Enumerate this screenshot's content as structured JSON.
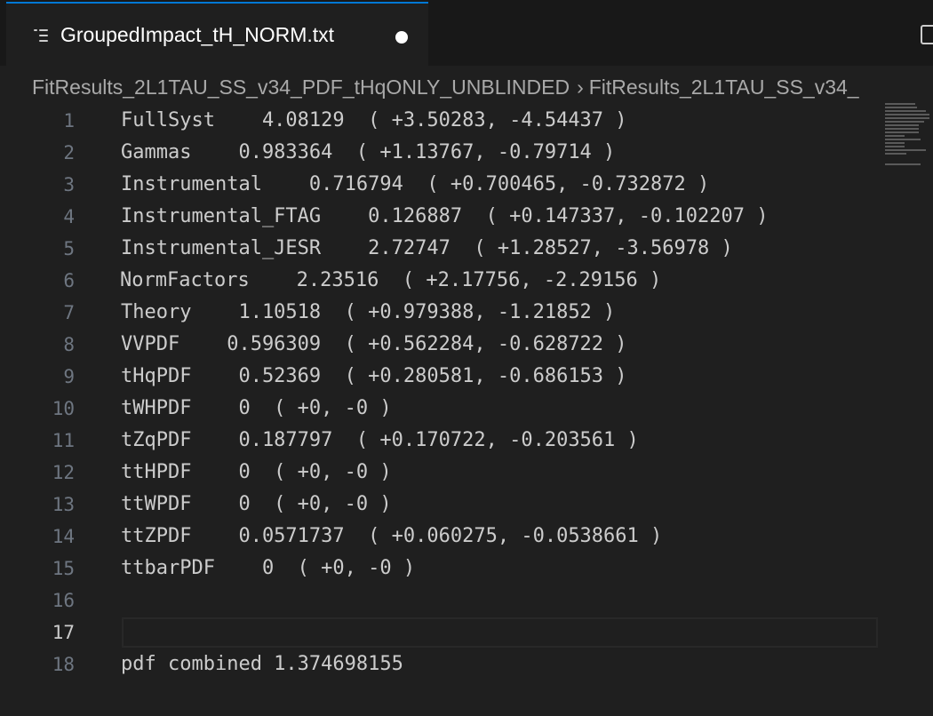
{
  "tab": {
    "title": "GroupedImpact_tH_NORM.txt",
    "dirty": true
  },
  "breadcrumb": [
    "FitResults_2L1TAU_SS_v34_PDF_tHqONLY_UNBLINDED",
    "FitResults_2L1TAU_SS_v34_"
  ],
  "breadcrumb_separator": "›",
  "editor": {
    "active_line": 17,
    "lines": [
      {
        "number": "1",
        "text": "FullSyst    4.08129  ( +3.50283, -4.54437 )"
      },
      {
        "number": "2",
        "text": "Gammas    0.983364  ( +1.13767, -0.79714 )"
      },
      {
        "number": "3",
        "text": "Instrumental    0.716794  ( +0.700465, -0.732872 )"
      },
      {
        "number": "4",
        "text": "Instrumental_FTAG    0.126887  ( +0.147337, -0.102207 )"
      },
      {
        "number": "5",
        "text": "Instrumental_JESR    2.72747  ( +1.28527, -3.56978 )"
      },
      {
        "number": "6",
        "text": "NormFactors    2.23516  ( +2.17756, -2.29156 )"
      },
      {
        "number": "7",
        "text": "Theory    1.10518  ( +0.979388, -1.21852 )"
      },
      {
        "number": "8",
        "text": "VVPDF    0.596309  ( +0.562284, -0.628722 )"
      },
      {
        "number": "9",
        "text": "tHqPDF    0.52369  ( +0.280581, -0.686153 )"
      },
      {
        "number": "10",
        "text": "tWHPDF    0  ( +0, -0 )"
      },
      {
        "number": "11",
        "text": "tZqPDF    0.187797  ( +0.170722, -0.203561 )"
      },
      {
        "number": "12",
        "text": "ttHPDF    0  ( +0, -0 )"
      },
      {
        "number": "13",
        "text": "ttWPDF    0  ( +0, -0 )"
      },
      {
        "number": "14",
        "text": "ttZPDF    0.0571737  ( +0.060275, -0.0538661 )"
      },
      {
        "number": "15",
        "text": "ttbarPDF    0  ( +0, -0 )"
      },
      {
        "number": "16",
        "text": ""
      },
      {
        "number": "17",
        "text": ""
      },
      {
        "number": "18",
        "text": "pdf combined 1.374698155"
      }
    ]
  },
  "colors": {
    "background": "#1f1f1f",
    "titlebar": "#181818",
    "tab_accent": "#0078d4",
    "text": "#cccccc",
    "line_number": "#6e7681",
    "breadcrumb": "#a9a9a9"
  },
  "icons": {
    "tab": "file-text-icon",
    "dirty": "unsaved-dot-icon",
    "split": "split-editor-icon",
    "breadcrumb_separator": "chevron-right-icon"
  }
}
